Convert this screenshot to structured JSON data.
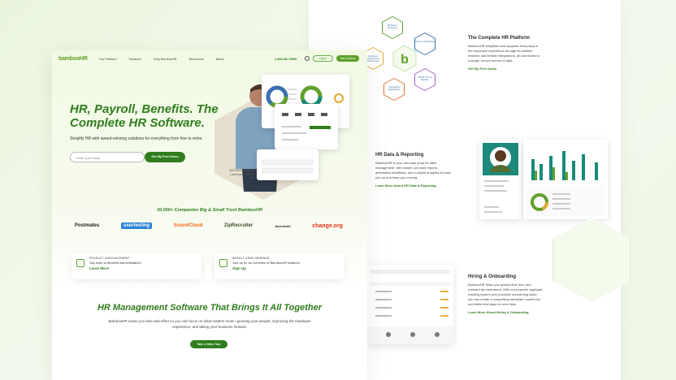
{
  "nav": {
    "logo": "bambooHR",
    "links": [
      "Our Platform",
      "Solutions",
      "Why BambooHR",
      "Resources",
      "About"
    ],
    "phone": "1-866-387-9595",
    "login": "Log In",
    "get_demo": "Get a Demo"
  },
  "hero": {
    "title": "HR, Payroll, Benefits. The Complete HR Software.",
    "subtitle": "Simplify HR with award-winning solutions for everything from hire to retire.",
    "email_placeholder": "Enter your email",
    "cta": "Get My Free Demo",
    "person_caption": "ANTHONY SANDERS Lorem ipsum dolor sit amet"
  },
  "trust": {
    "title": "30,000+ Companies Big & Small Trust BambooHR",
    "logos": [
      "Postmates",
      "usertesting",
      "SoundCloud",
      "ZipRecruiter",
      "Jackrabbit",
      "change.org"
    ]
  },
  "promos": [
    {
      "tag": "PRODUCT ANNOUNCEMENT",
      "text": "Say hello to Benefits Administration!",
      "link": "Learn More"
    },
    {
      "tag": "WEEKLY DEMO WEBINAR",
      "text": "Join us for an overview of BambooHR features.",
      "link": "Sign Up"
    }
  ],
  "section2": {
    "title": "HR Management Software That Brings It All Together",
    "body": "BambooHR saves you time and effort so you can focus on what matters most—growing your people, improving the employee experience, and taking your business forward.",
    "cta": "Take a Video Tour"
  },
  "right": {
    "platform": {
      "title": "The Complete HR Platform",
      "body": "BambooHR simplifies and supports every step in the employee experience through its intuitive features and flexible integrations, all connected to a single, secure source of data.",
      "link": "Get My Free Demo"
    },
    "data": {
      "title": "HR Data & Reporting",
      "body": "BambooHR is your one-stop shop for data management, with instant, pre-built reports, automated workflows, and in-depth analytics to back you up and keep you moving.",
      "link": "Learn More About HR Data & Reporting"
    },
    "hiring": {
      "title": "Hiring & Onboarding",
      "body": "BambooHR helps you quickly find, hire, and onboard the best talent. With our powerful applicant tracking system and proactive onboarding tasks, you can create a compelling candidate experience and better first days for new hires.",
      "link": "Learn More About Hiring & Onboarding"
    },
    "hexes": [
      "HR Data & Reporting",
      "Hiring & Onboarding",
      "Payroll, Time & Benefits",
      "Employee Experience & Performance",
      "Integrations Marketplace",
      "Employee Experience"
    ]
  },
  "colors": {
    "primary": "#2f7d1c",
    "accent": "#5fa12c",
    "teal": "#1a8a7a"
  }
}
